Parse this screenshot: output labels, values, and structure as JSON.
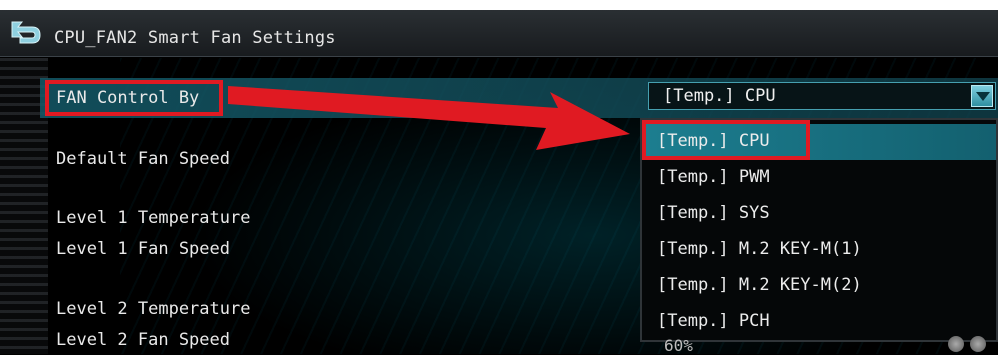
{
  "header": {
    "title": "CPU_FAN2 Smart Fan Settings"
  },
  "settings": [
    {
      "label": "FAN Control By"
    },
    {
      "label": "Default Fan Speed"
    },
    {
      "label": "Level 1 Temperature"
    },
    {
      "label": "Level 1 Fan Speed"
    },
    {
      "label": "Level 2 Temperature"
    },
    {
      "label": "Level 2 Fan Speed"
    }
  ],
  "fan_control": {
    "selected": "[Temp.] CPU",
    "options": [
      "[Temp.] CPU",
      "[Temp.] PWM",
      "[Temp.] SYS",
      "[Temp.] M.2 KEY-M(1)",
      "[Temp.] M.2 KEY-M(2)",
      "[Temp.] PCH"
    ]
  },
  "level2_fan_speed_value": "60%",
  "colors": {
    "highlight": "#1c7e90",
    "annotation_red": "#e01a22"
  },
  "icons": {
    "back": "back-arrow-icon",
    "dropdown_arrow": "chevron-down-icon"
  }
}
